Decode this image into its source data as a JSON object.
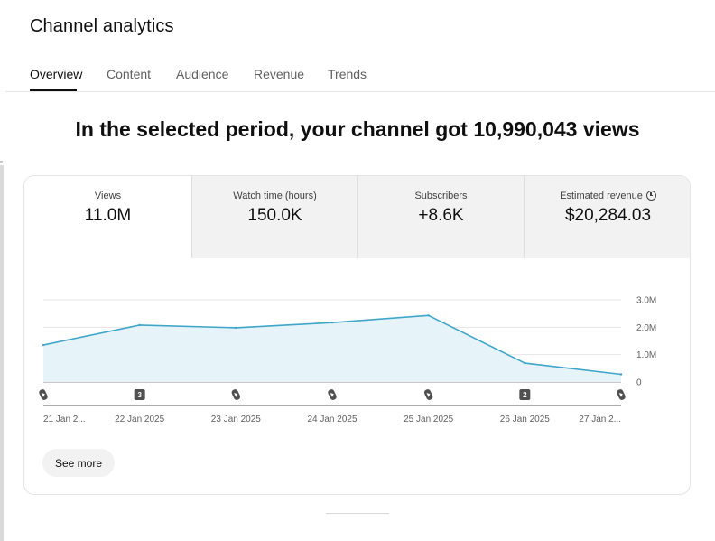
{
  "page": {
    "title": "Channel analytics"
  },
  "tabs": [
    {
      "label": "Overview",
      "active": true
    },
    {
      "label": "Content",
      "active": false
    },
    {
      "label": "Audience",
      "active": false
    },
    {
      "label": "Revenue",
      "active": false
    },
    {
      "label": "Trends",
      "active": false
    }
  ],
  "headline": "In the selected period, your channel got 10,990,043 views",
  "metrics": [
    {
      "label": "Views",
      "value": "11.0M",
      "active": true
    },
    {
      "label": "Watch time (hours)",
      "value": "150.0K",
      "active": false
    },
    {
      "label": "Subscribers",
      "value": "+8.6K",
      "active": false
    },
    {
      "label": "Estimated revenue",
      "value": "$20,284.03",
      "active": false,
      "icon": "clock-icon"
    }
  ],
  "chart_data": {
    "type": "area",
    "title": "",
    "xlabel": "",
    "ylabel": "",
    "x": [
      "21 Jan 2...",
      "22 Jan 2025",
      "23 Jan 2025",
      "24 Jan 2025",
      "25 Jan 2025",
      "26 Jan 2025",
      "27 Jan 2..."
    ],
    "series": [
      {
        "values": [
          1350000,
          2080000,
          1980000,
          2170000,
          2430000,
          690000,
          280000
        ]
      }
    ],
    "yticks": [
      "3.0M",
      "2.0M",
      "1.0M",
      "0"
    ],
    "ylim": [
      0,
      3000000
    ],
    "grid": true,
    "axis_position": "right",
    "line_color": "#3ea6c8",
    "fill_color": "#e6f4f9",
    "markers": [
      {
        "type": "shorts-icon",
        "label": ""
      },
      {
        "type": "count-badge",
        "label": "3"
      },
      {
        "type": "shorts-icon",
        "label": ""
      },
      {
        "type": "shorts-icon",
        "label": ""
      },
      {
        "type": "shorts-icon",
        "label": ""
      },
      {
        "type": "count-badge",
        "label": "2"
      },
      {
        "type": "shorts-icon",
        "label": ""
      }
    ]
  },
  "actions": {
    "see_more_label": "See more"
  }
}
